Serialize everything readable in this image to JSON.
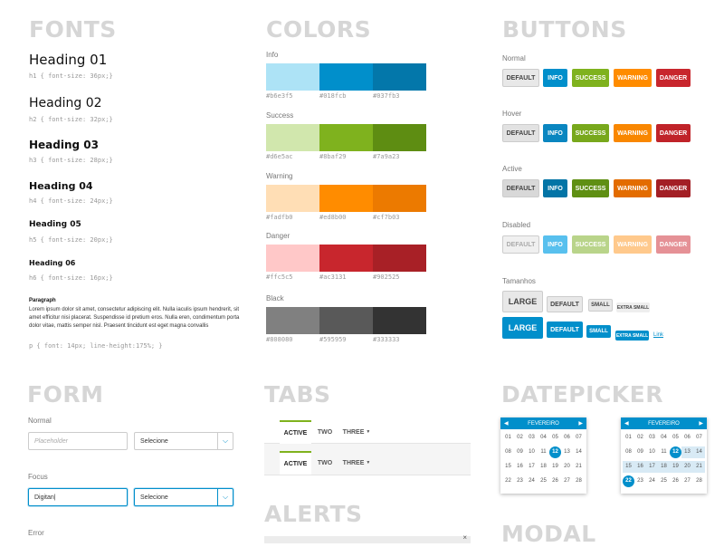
{
  "fonts": {
    "title": "FONTS",
    "h1": "Heading 01",
    "h1_spec": "h1 { font-size: 36px;}",
    "h2": "Heading 02",
    "h2_spec": "h2 { font-size: 32px;}",
    "h3": "Heading 03",
    "h3_spec": "h3 { font-size: 28px;}",
    "h4": "Heading 04",
    "h4_spec": "h4 { font-size: 24px;}",
    "h5": "Heading 05",
    "h5_spec": "h5 { font-size: 20px;}",
    "h6": "Heading 06",
    "h6_spec": "h6 { font-size: 16px;}",
    "paragraph_label": "Paragraph",
    "paragraph_text": "Lorem ipsum dolor sit amet, consectetur adipiscing elit. Nulla iaculis ipsum hendrerit, sit amet efficitur nisi placerat. Suspendisse id pretium eros. Nulla eren, condimentum porta dolor vitae, mattis semper nisl. Praesent tincidunt est eget magna convallis",
    "paragraph_spec": "p { font: 14px; line-height:175%; }"
  },
  "colors": {
    "title": "COLORS",
    "groups": [
      {
        "name": "Info",
        "hex": [
          "#b6e3f5",
          "#018fcb",
          "#037fb3"
        ],
        "swatches": [
          "#ade3f6",
          "#018fcb",
          "#0377aa"
        ]
      },
      {
        "name": "Success",
        "hex": [
          "#d6e5ac",
          "#8baf29",
          "#7a9a23"
        ],
        "swatches": [
          "#d1e7ad",
          "#7fb21e",
          "#5e8d12"
        ]
      },
      {
        "name": "Warning",
        "hex": [
          "#fadfb0",
          "#ed8b00",
          "#cf7b03"
        ],
        "swatches": [
          "#ffdeb5",
          "#ff8c00",
          "#ec7a00"
        ]
      },
      {
        "name": "Danger",
        "hex": [
          "#ffc5c5",
          "#ac3131",
          "#902525"
        ],
        "swatches": [
          "#ffc8c8",
          "#c8262d",
          "#a82026"
        ]
      },
      {
        "name": "Black",
        "hex": [
          "#808080",
          "#595959",
          "#333333"
        ],
        "swatches": [
          "#808080",
          "#595959",
          "#333333"
        ]
      }
    ]
  },
  "buttons": {
    "title": "BUTTONS",
    "states": [
      "Normal",
      "Hover",
      "Active",
      "Disabled"
    ],
    "labels": [
      "DEFAULT",
      "INFO",
      "SUCCESS",
      "WARNING",
      "DANGER"
    ],
    "sizes_title": "Tamanhos",
    "size_labels": [
      "LARGE",
      "DEFAULT",
      "SMALL",
      "EXTRA SMALL"
    ],
    "link": "Link"
  },
  "form": {
    "title": "FORM",
    "normal_label": "Normal",
    "placeholder": "Placeholder",
    "select_value": "Selecione",
    "focus_label": "Focus",
    "focus_value": "Digitan|",
    "error_label": "Error"
  },
  "tabs": {
    "title": "TABS",
    "items": [
      "ACTIVE",
      "TWO",
      "THREE"
    ]
  },
  "alerts": {
    "title": "ALERTS"
  },
  "datepicker": {
    "title": "DATEPICKER",
    "month": "FEVEREIRO",
    "days": [
      "01",
      "02",
      "03",
      "04",
      "05",
      "06",
      "07",
      "08",
      "09",
      "10",
      "11",
      "12",
      "13",
      "14",
      "15",
      "16",
      "17",
      "18",
      "19",
      "20",
      "21",
      "22",
      "23",
      "24",
      "25",
      "26",
      "27",
      "28"
    ]
  },
  "modal": {
    "title": "MODAL"
  }
}
